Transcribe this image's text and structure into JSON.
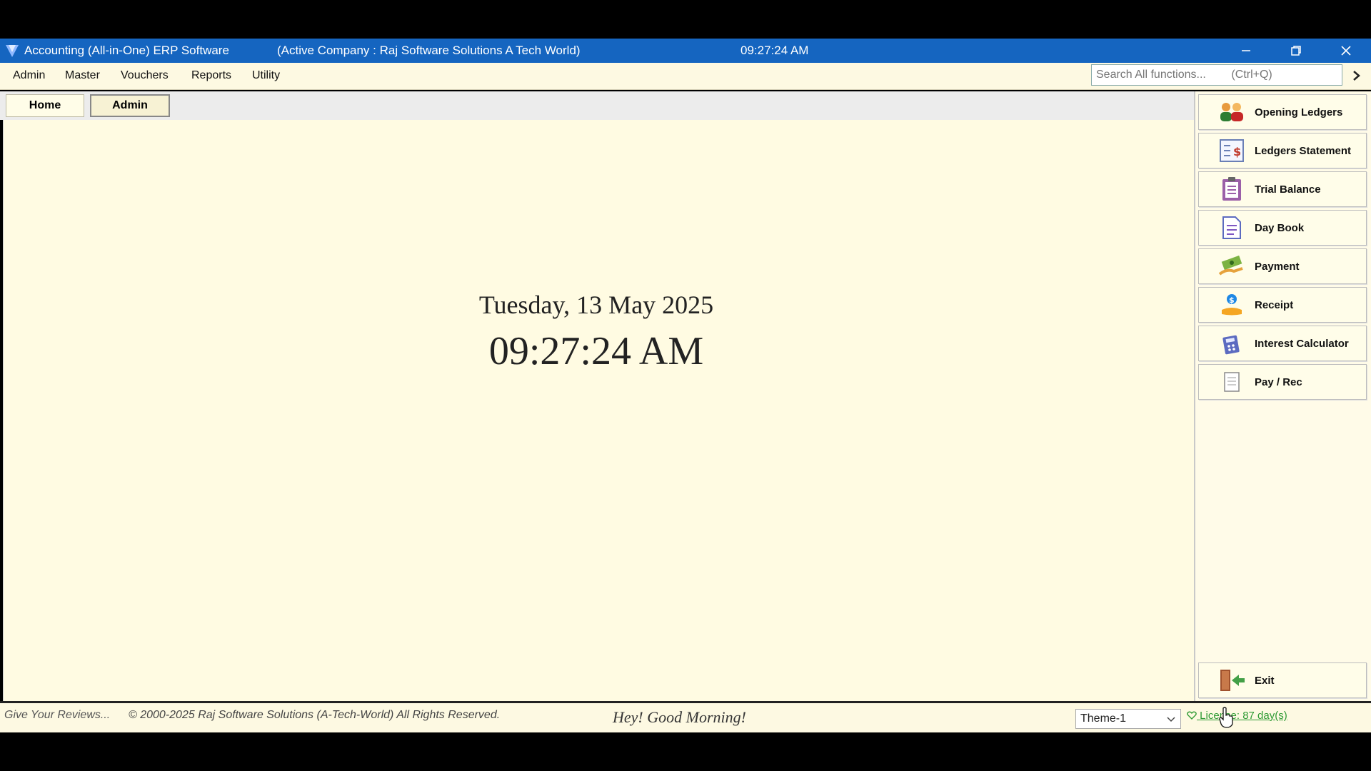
{
  "titlebar": {
    "app_title": "Accounting (All-in-One) ERP Software",
    "company": "(Active Company :  Raj Software Solutions A Tech World)",
    "clock": "09:27:24 AM",
    "icons": [
      "minimize-icon",
      "maximize-icon",
      "close-icon"
    ]
  },
  "menu": {
    "items": [
      "Admin",
      "Master",
      "Vouchers",
      "Reports",
      "Utility"
    ]
  },
  "search": {
    "placeholder": "Search All functions...        (Ctrl+Q)"
  },
  "tabs": [
    "Home",
    "Admin"
  ],
  "main": {
    "date": "Tuesday, 13 May 2025",
    "time": "09:27:24 AM"
  },
  "quick_buttons": [
    {
      "label": "Opening Ledgers",
      "icon": "users-icon"
    },
    {
      "label": "Ledgers Statement",
      "icon": "ledger-statement-icon"
    },
    {
      "label": "Trial Balance",
      "icon": "clipboard-icon"
    },
    {
      "label": "Day Book",
      "icon": "document-icon"
    },
    {
      "label": "Payment",
      "icon": "money-icon"
    },
    {
      "label": "Receipt",
      "icon": "receipt-hand-icon"
    },
    {
      "label": "Interest Calculator",
      "icon": "calculator-icon"
    },
    {
      "label": "Pay / Rec",
      "icon": "page-icon"
    }
  ],
  "exit_button": {
    "label": "Exit",
    "icon": "exit-door-icon"
  },
  "status": {
    "review": "Give Your Reviews...",
    "copyright": "© 2000-2025 Raj Software Solutions (A-Tech-World) All Rights Reserved.",
    "greeting": "Hey! Good Morning!",
    "theme_selected": "Theme-1",
    "license": "License: 87 day(s)"
  },
  "colors": {
    "titlebar": "#1565c0",
    "background": "#fffbe2",
    "license": "#2e9a33"
  }
}
